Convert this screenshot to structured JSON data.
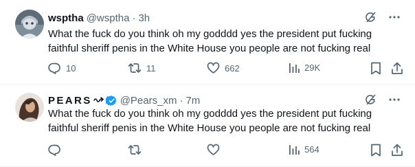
{
  "tweets": [
    {
      "name": "wsptha",
      "handle": "@wsptha",
      "separator": "·",
      "time": "3h",
      "text": "What the fuck do you think oh my godddd yes the president put fucking\nfaithful sheriff penis in the White House you people are not fucking real",
      "replies": "10",
      "retweets": "11",
      "likes": "662",
      "views": "29K"
    },
    {
      "name": "PEARS",
      "handle": "@Pears_xm",
      "separator": "·",
      "time": "7m",
      "text": "What the fuck do you think oh my godddd yes the president put fucking\nfaithful sheriff penis in the White House you people are not fucking real",
      "replies": "",
      "retweets": "",
      "likes": "",
      "views": "564"
    }
  ],
  "icons": {
    "reply": "reply-icon",
    "retweet": "retweet-icon",
    "like": "heart-icon",
    "views": "views-icon",
    "bookmark": "bookmark-icon",
    "share": "share-icon",
    "grok": "grok-icon",
    "more": "more-icon",
    "verified": "verified-badge-icon"
  },
  "colors": {
    "text": "#0f1419",
    "secondary": "#536471",
    "verified": "#1d9bf0",
    "divider": "#eff3f4"
  }
}
